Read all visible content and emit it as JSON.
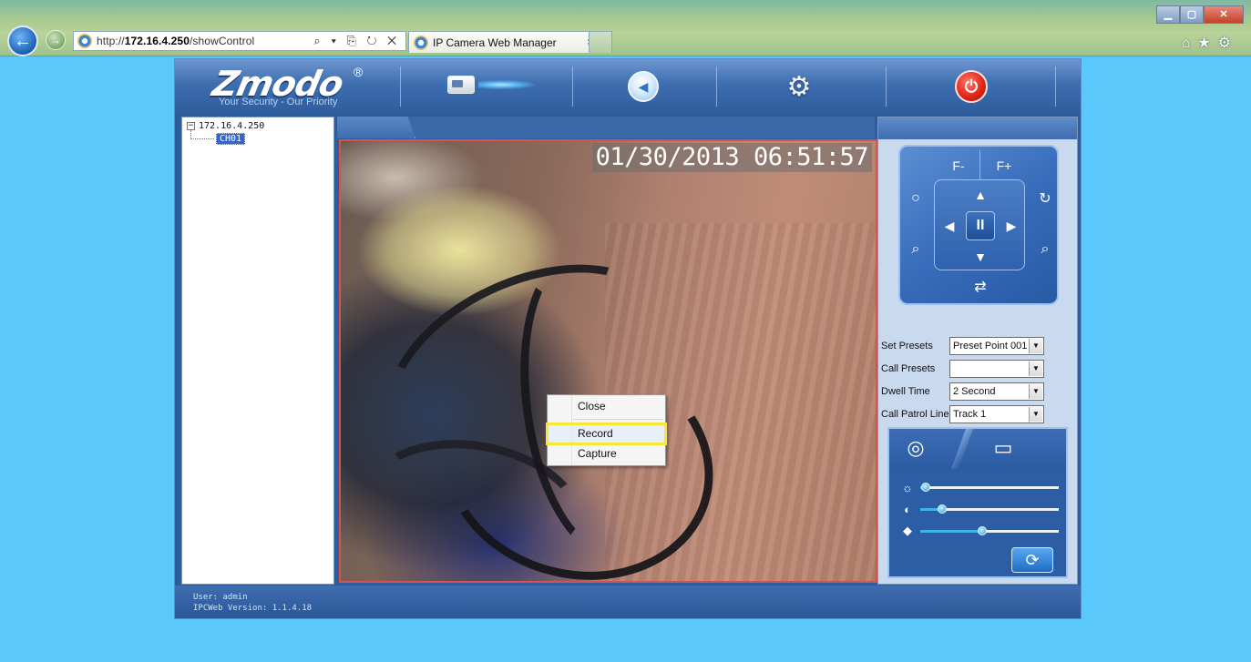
{
  "browser": {
    "url_prefix": "http://",
    "url_host": "172.16.4.250",
    "url_path": "/showControl",
    "address_tools": "⌕ ▾ ⎘ ↻ ✕",
    "tab_title": "IP Camera Web Manager",
    "tab_close": "×",
    "window_controls": {
      "minimize": "▁",
      "maximize": "▢",
      "close": "✕"
    },
    "toolbar_icons": [
      "home-icon",
      "favorites-icon",
      "tools-gear-icon"
    ]
  },
  "header": {
    "logo_text": "Zmodo",
    "logo_reg": "®",
    "tagline": "Your Security - Our Priority",
    "icons": [
      "live-view-camera-icon",
      "back-icon",
      "settings-gear-icon",
      "power-icon"
    ]
  },
  "tree": {
    "root_label": "172.16.4.250",
    "toggle": "−",
    "child_label": "CH01"
  },
  "video": {
    "timestamp": "01/30/2013 06:51:57"
  },
  "context_menu": {
    "items": [
      "Close",
      "Record",
      "Capture"
    ],
    "highlighted": "Record"
  },
  "ptz": {
    "focus_minus": "F-",
    "focus_plus": "F+",
    "center_symbol": "II",
    "icons": [
      "pan-up-icon",
      "pan-down-icon",
      "pan-left-icon",
      "pan-right-icon",
      "iris-icon",
      "auto-rotate-icon",
      "zoom-out-icon",
      "zoom-in-icon",
      "cruise-icon",
      "pause-icon"
    ]
  },
  "presets": [
    {
      "label": "Set Presets",
      "value": "Preset Point 001"
    },
    {
      "label": "Call Presets",
      "value": ""
    },
    {
      "label": "Dwell Time",
      "value": "2 Second"
    },
    {
      "label": "Call Patrol Line",
      "value": "Track 1"
    }
  ],
  "image_adjust": {
    "tabs": [
      "camera-settings-icon",
      "display-settings-icon"
    ],
    "sliders": [
      {
        "name": "brightness",
        "icon": "brightness-icon",
        "level": 0.04
      },
      {
        "name": "contrast",
        "icon": "contrast-icon",
        "level": 0.16
      },
      {
        "name": "saturation",
        "icon": "saturation-icon",
        "level": 0.45
      }
    ],
    "refresh_icon": "refresh-icon"
  },
  "footer": {
    "user_line": "User: admin",
    "version_line": "IPCWeb Version: 1.1.4.18"
  },
  "colors": {
    "page_bg": "#5ac8fa",
    "video_border": "#d4534d",
    "menu_highlight": "#f7e737",
    "tree_selected": "#3064d8"
  }
}
